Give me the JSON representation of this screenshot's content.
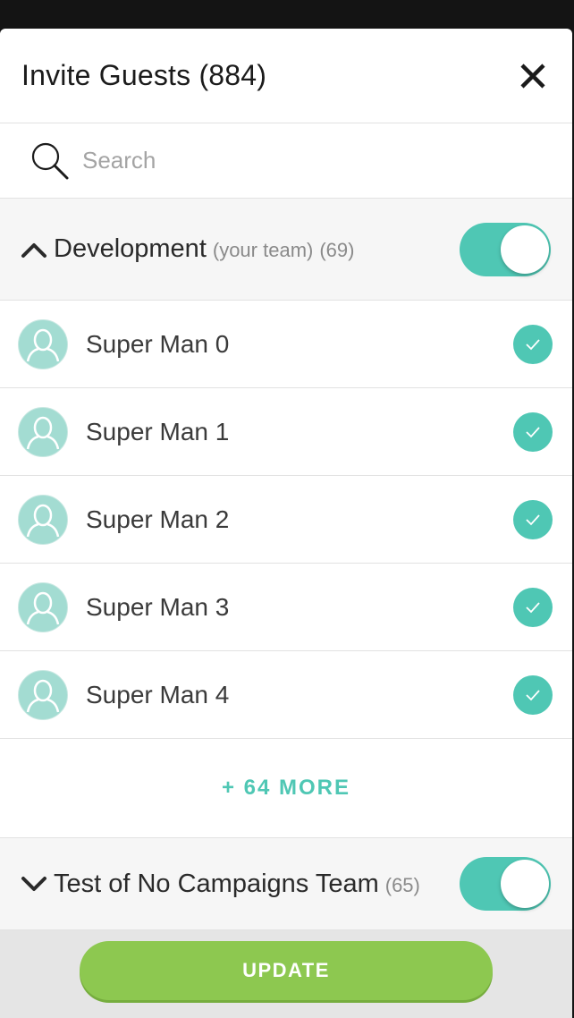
{
  "header": {
    "title": "Invite Guests (884)"
  },
  "search": {
    "placeholder": "Search",
    "value": ""
  },
  "teams": [
    {
      "name": "Development",
      "note": "(your team)",
      "count": "(69)",
      "expanded": true,
      "selected": true,
      "members": [
        {
          "name": "Super Man 0",
          "checked": true
        },
        {
          "name": "Super Man 1",
          "checked": true
        },
        {
          "name": "Super Man 2",
          "checked": true
        },
        {
          "name": "Super Man 3",
          "checked": true
        },
        {
          "name": "Super Man 4",
          "checked": true
        }
      ],
      "more_label": "+ 64 MORE"
    },
    {
      "name": "Test of No Campaigns Team",
      "count": "(65)",
      "expanded": false,
      "selected": true
    }
  ],
  "footer": {
    "update_label": "UPDATE"
  },
  "colors": {
    "accent": "#4fc7b4",
    "avatar": "#a3dcd2",
    "update_button": "#8dc850",
    "backdrop": "#141414"
  },
  "icons": [
    "close-icon",
    "search-icon",
    "chevron-up-icon",
    "chevron-down-icon",
    "user-avatar-icon",
    "checkmark-icon"
  ]
}
